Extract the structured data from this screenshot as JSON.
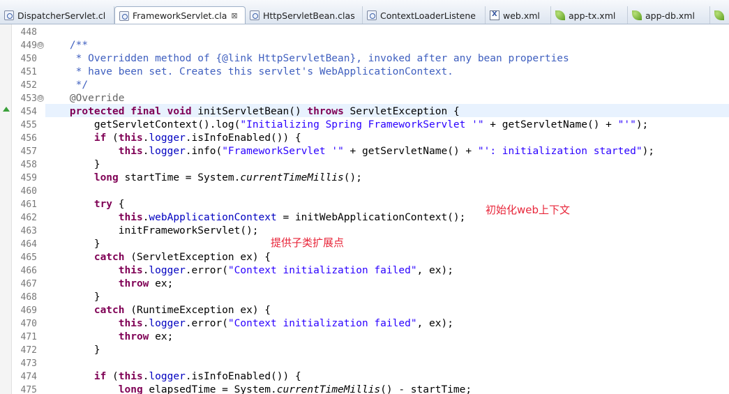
{
  "tabs": [
    {
      "label": "DispatcherServlet.cl",
      "icon": "java-file-icon",
      "active": false
    },
    {
      "label": "FrameworkServlet.cla",
      "icon": "java-file-icon",
      "active": true,
      "close": "⊠"
    },
    {
      "label": "HttpServletBean.clas",
      "icon": "java-file-icon",
      "active": false
    },
    {
      "label": "ContextLoaderListene",
      "icon": "java-file-icon",
      "active": false
    },
    {
      "label": "web.xml",
      "icon": "xml-file-icon",
      "active": false
    },
    {
      "label": "app-tx.xml",
      "icon": "spring-leaf-icon",
      "active": false
    },
    {
      "label": "app-db.xml",
      "icon": "spring-leaf-icon",
      "active": false
    }
  ],
  "editor": {
    "lines": [
      {
        "n": "448",
        "fold": "",
        "t": []
      },
      {
        "n": "449",
        "fold": "⊖",
        "t": [
          [
            "    ",
            ""
          ],
          [
            "/**",
            "cmt"
          ]
        ]
      },
      {
        "n": "450",
        "fold": "",
        "t": [
          [
            "     ",
            ""
          ],
          [
            "* Overridden method of {@link HttpServletBean}, invoked after any bean properties",
            "cmt"
          ]
        ]
      },
      {
        "n": "451",
        "fold": "",
        "t": [
          [
            "     ",
            ""
          ],
          [
            "* have been set. Creates this servlet's WebApplicationContext.",
            "cmt"
          ]
        ]
      },
      {
        "n": "452",
        "fold": "",
        "t": [
          [
            "     ",
            ""
          ],
          [
            "*/",
            "cmt"
          ]
        ]
      },
      {
        "n": "453",
        "fold": "⊖",
        "t": [
          [
            "    ",
            ""
          ],
          [
            "@Override",
            "ann"
          ]
        ]
      },
      {
        "n": "454",
        "fold": "",
        "t": [
          [
            "    ",
            ""
          ],
          [
            "protected",
            "kw"
          ],
          [
            " ",
            ""
          ],
          [
            "final",
            "kw"
          ],
          [
            " ",
            ""
          ],
          [
            "void",
            "kw"
          ],
          [
            " initServletBean() ",
            ""
          ],
          [
            "throws",
            "kw"
          ],
          [
            " ServletException {",
            ""
          ]
        ]
      },
      {
        "n": "455",
        "fold": "",
        "t": [
          [
            "        getServletContext().log(",
            ""
          ],
          [
            "\"Initializing Spring FrameworkServlet '\"",
            "str"
          ],
          [
            " + getServletName() + ",
            ""
          ],
          [
            "\"'\"",
            "str"
          ],
          [
            ");",
            ""
          ]
        ]
      },
      {
        "n": "456",
        "fold": "",
        "t": [
          [
            "        ",
            ""
          ],
          [
            "if",
            "kw"
          ],
          [
            " (",
            ""
          ],
          [
            "this",
            "kw"
          ],
          [
            ".",
            ""
          ],
          [
            "logger",
            "fld"
          ],
          [
            ".isInfoEnabled()) {",
            ""
          ]
        ]
      },
      {
        "n": "457",
        "fold": "",
        "t": [
          [
            "            ",
            ""
          ],
          [
            "this",
            "kw"
          ],
          [
            ".",
            ""
          ],
          [
            "logger",
            "fld"
          ],
          [
            ".info(",
            ""
          ],
          [
            "\"FrameworkServlet '\"",
            "str"
          ],
          [
            " + getServletName() + ",
            ""
          ],
          [
            "\"': initialization started\"",
            "str"
          ],
          [
            ");",
            ""
          ]
        ]
      },
      {
        "n": "458",
        "fold": "",
        "t": [
          [
            "        }",
            ""
          ]
        ]
      },
      {
        "n": "459",
        "fold": "",
        "t": [
          [
            "        ",
            ""
          ],
          [
            "long",
            "kw"
          ],
          [
            " startTime = System.",
            ""
          ],
          [
            "currentTimeMillis",
            "it"
          ],
          [
            "();",
            ""
          ]
        ]
      },
      {
        "n": "460",
        "fold": "",
        "t": []
      },
      {
        "n": "461",
        "fold": "",
        "t": [
          [
            "        ",
            ""
          ],
          [
            "try",
            "kw"
          ],
          [
            " {",
            ""
          ]
        ]
      },
      {
        "n": "462",
        "fold": "",
        "t": [
          [
            "            ",
            ""
          ],
          [
            "this",
            "kw"
          ],
          [
            ".",
            ""
          ],
          [
            "webApplicationContext",
            "fld"
          ],
          [
            " = initWebApplicationContext();",
            ""
          ]
        ]
      },
      {
        "n": "463",
        "fold": "",
        "t": [
          [
            "            initFrameworkServlet();",
            ""
          ]
        ]
      },
      {
        "n": "464",
        "fold": "",
        "t": [
          [
            "        }",
            ""
          ]
        ]
      },
      {
        "n": "465",
        "fold": "",
        "t": [
          [
            "        ",
            ""
          ],
          [
            "catch",
            "kw"
          ],
          [
            " (ServletException ex) {",
            ""
          ]
        ]
      },
      {
        "n": "466",
        "fold": "",
        "t": [
          [
            "            ",
            ""
          ],
          [
            "this",
            "kw"
          ],
          [
            ".",
            ""
          ],
          [
            "logger",
            "fld"
          ],
          [
            ".error(",
            ""
          ],
          [
            "\"Context initialization failed\"",
            "str"
          ],
          [
            ", ex);",
            ""
          ]
        ]
      },
      {
        "n": "467",
        "fold": "",
        "t": [
          [
            "            ",
            ""
          ],
          [
            "throw",
            "kw"
          ],
          [
            " ex;",
            ""
          ]
        ]
      },
      {
        "n": "468",
        "fold": "",
        "t": [
          [
            "        }",
            ""
          ]
        ]
      },
      {
        "n": "469",
        "fold": "",
        "t": [
          [
            "        ",
            ""
          ],
          [
            "catch",
            "kw"
          ],
          [
            " (RuntimeException ex) {",
            ""
          ]
        ]
      },
      {
        "n": "470",
        "fold": "",
        "t": [
          [
            "            ",
            ""
          ],
          [
            "this",
            "kw"
          ],
          [
            ".",
            ""
          ],
          [
            "logger",
            "fld"
          ],
          [
            ".error(",
            ""
          ],
          [
            "\"Context initialization failed\"",
            "str"
          ],
          [
            ", ex);",
            ""
          ]
        ]
      },
      {
        "n": "471",
        "fold": "",
        "t": [
          [
            "            ",
            ""
          ],
          [
            "throw",
            "kw"
          ],
          [
            " ex;",
            ""
          ]
        ]
      },
      {
        "n": "472",
        "fold": "",
        "t": [
          [
            "        }",
            ""
          ]
        ]
      },
      {
        "n": "473",
        "fold": "",
        "t": []
      },
      {
        "n": "474",
        "fold": "",
        "t": [
          [
            "        ",
            ""
          ],
          [
            "if",
            "kw"
          ],
          [
            " (",
            ""
          ],
          [
            "this",
            "kw"
          ],
          [
            ".",
            ""
          ],
          [
            "logger",
            "fld"
          ],
          [
            ".isInfoEnabled()) {",
            ""
          ]
        ]
      },
      {
        "n": "475",
        "fold": "",
        "t": [
          [
            "            ",
            ""
          ],
          [
            "long",
            "kw"
          ],
          [
            " elapsedTime = System.",
            ""
          ],
          [
            "currentTimeMillis",
            "it"
          ],
          [
            "() - startTime;",
            ""
          ]
        ]
      }
    ]
  },
  "annotations": {
    "init_web_context": "初始化web上下文",
    "subclass_hook": "提供子类扩展点"
  },
  "colors": {
    "keyword": "#7f0055",
    "field": "#0000c0",
    "string": "#2a00ff",
    "comment": "#3f5fbf",
    "annotation": "#646464",
    "note": "#e8263a",
    "current_line": "#e8f2fe"
  }
}
